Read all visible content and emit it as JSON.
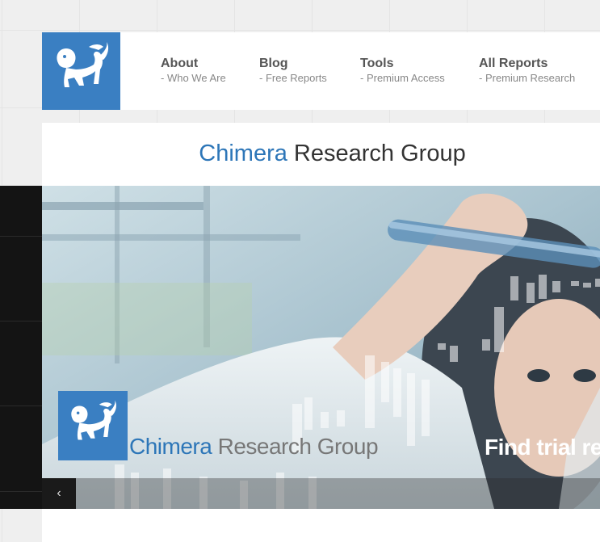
{
  "brand": {
    "name_accent": "Chimera",
    "name_rest": " Research Group",
    "logo_icon": "griffin-lion-logo"
  },
  "nav": [
    {
      "label": "About",
      "sub": "- Who We Are"
    },
    {
      "label": "Blog",
      "sub": "- Free Reports"
    },
    {
      "label": "Tools",
      "sub": "- Premium Access"
    },
    {
      "label": "All Reports",
      "sub": "- Premium Research"
    }
  ],
  "hero": {
    "brand_accent": "Chimera",
    "brand_rest": " Research Group",
    "caption": "Find trial resu",
    "prev_icon": "‹"
  },
  "colors": {
    "accent": "#3a7fc2",
    "title_accent": "#2d76b8"
  }
}
